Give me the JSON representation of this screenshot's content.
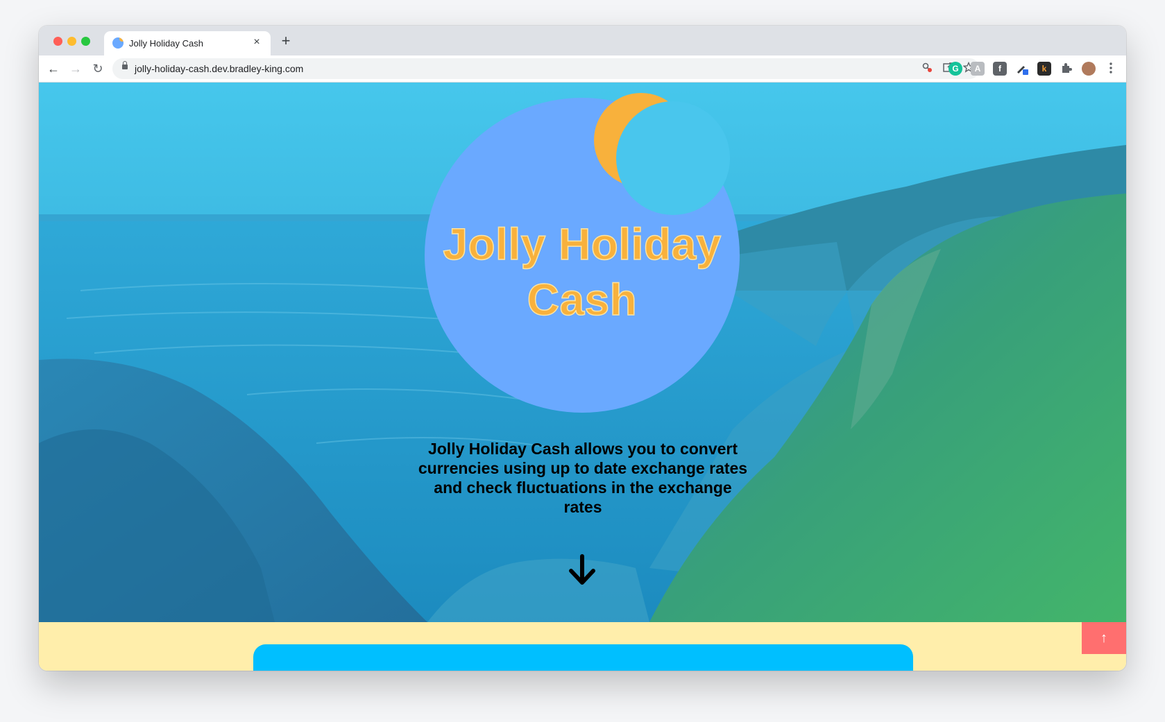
{
  "browser": {
    "tab_title": "Jolly Holiday Cash",
    "tab_close": "×",
    "new_tab": "+",
    "url": "jolly-holiday-cash.dev.bradley-king.com",
    "nav": {
      "back": "←",
      "forward": "→",
      "reload": "↻"
    },
    "omnibox_icons": [
      "password-key-icon",
      "share-icon",
      "bookmark-star-icon"
    ],
    "extensions": [
      "grammarly-icon",
      "extension-a-icon",
      "extension-f-icon",
      "pen-extension-icon",
      "k-extension-icon",
      "puzzle-icon",
      "profile-avatar",
      "menu-dots-icon"
    ]
  },
  "hero": {
    "logo_line1": "Jolly Holiday",
    "logo_line2": "Cash",
    "tagline": "Jolly Holiday Cash allows you to convert currencies using up to date exchange rates and check fluctuations in the exchange rates",
    "scroll_arrow_icon": "arrow-down-icon"
  },
  "scroll_top": {
    "label": "↑"
  },
  "colors": {
    "logo_circle": "#6aa9ff",
    "logo_text": "#f8b13c",
    "section_bg": "#ffeeab",
    "card": "#00bfff",
    "scroll_top_button": "#ff6f6f"
  }
}
